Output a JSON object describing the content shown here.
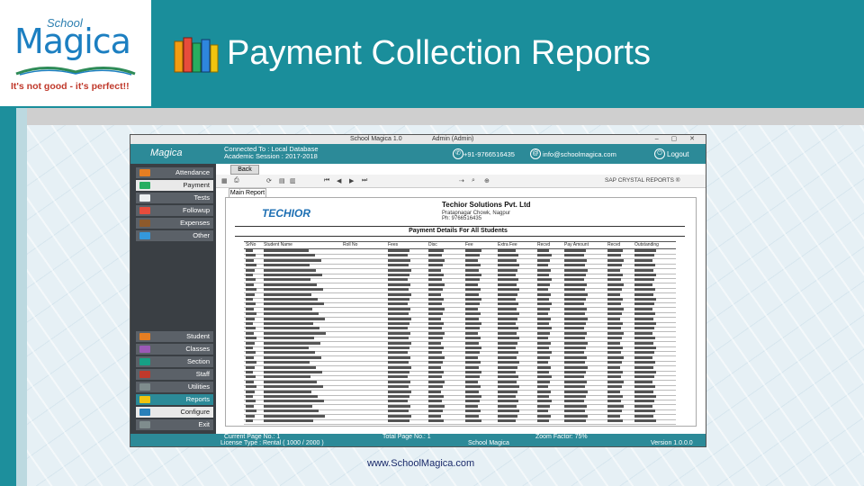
{
  "slide": {
    "title": "Payment Collection Reports",
    "url": "www.SchoolMagica.com"
  },
  "logo": {
    "school": "School",
    "brand": "Magica",
    "tagline": "It's not good - it's perfect!!"
  },
  "app": {
    "titlebar": {
      "title": "School Magica 1.0",
      "user": "Admin (Admin)",
      "buttons": "– ▢ ✕"
    },
    "header": {
      "brand": "Magica",
      "connection": "Connected To : Local Database",
      "session": "Academic Session : 2017-2018",
      "phone": "+91-9766516435",
      "email": "info@schoolmagica.com",
      "logout": "Logout"
    },
    "sidebar_top": [
      {
        "label": "Attendance",
        "icon": "attendance-icon",
        "color": "#e67e22"
      },
      {
        "label": "Payment",
        "icon": "payment-icon",
        "color": "#27ae60",
        "active": true
      },
      {
        "label": "Tests",
        "icon": "tests-icon",
        "color": "#ecf0f1"
      },
      {
        "label": "Followup",
        "icon": "followup-icon",
        "color": "#e74c3c"
      },
      {
        "label": "Expenses",
        "icon": "expenses-icon",
        "color": "#8e5a2b"
      },
      {
        "label": "Other",
        "icon": "other-icon",
        "color": "#3498db"
      }
    ],
    "sidebar_bottom": [
      {
        "label": "Student",
        "icon": "student-icon",
        "color": "#e67e22"
      },
      {
        "label": "Classes",
        "icon": "classes-icon",
        "color": "#9b59b6"
      },
      {
        "label": "Section",
        "icon": "section-icon",
        "color": "#16a085"
      },
      {
        "label": "Staff",
        "icon": "staff-icon",
        "color": "#c0392b"
      },
      {
        "label": "Utilities",
        "icon": "utilities-icon",
        "color": "#7f8c8d"
      },
      {
        "label": "Reports",
        "icon": "reports-icon",
        "color": "#f1c40f",
        "active": true
      },
      {
        "label": "Configure",
        "icon": "configure-icon",
        "color": "#2980b9"
      },
      {
        "label": "Exit",
        "icon": "exit-icon",
        "color": "#7f8c8d"
      }
    ],
    "back_label": "Back",
    "toolbar_right": "SAP CRYSTAL REPORTS ®",
    "main_tab": "Main Report",
    "report": {
      "company_logo": "TECHIOR",
      "company_name": "Techior Solutions Pvt. Ltd",
      "address": "Pratapnagar Chowk, Nagpur",
      "phone": "Ph: 9766516435",
      "title": "Payment Details For All Students",
      "columns": [
        "SrNo",
        "Student Name",
        "Roll No",
        "Fees",
        "Disc",
        "Fee",
        "Extra Fee",
        "Recvd",
        "Pay Amount",
        "Recvd",
        "Outstanding"
      ]
    },
    "status": {
      "current_page": "Current Page No.: 1",
      "total_page": "Total Page No.: 1",
      "app": "School Magica",
      "zoom": "Zoom Factor: 75%",
      "license": "License Type : Rental ( 1000 / 2000 )",
      "version": "Version 1.0.0.0"
    }
  }
}
